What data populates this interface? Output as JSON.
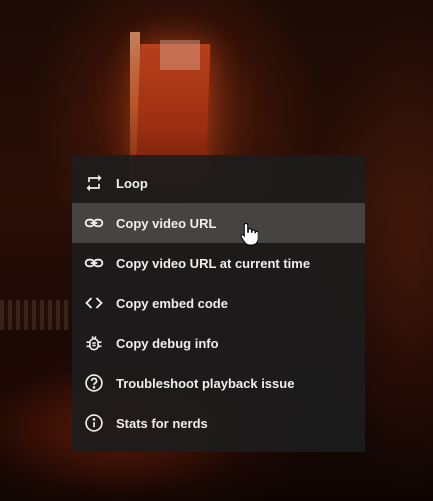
{
  "menu": {
    "items": [
      {
        "label": "Loop",
        "icon": "loop-icon"
      },
      {
        "label": "Copy video URL",
        "icon": "link-icon",
        "hovered": true
      },
      {
        "label": "Copy video URL at current time",
        "icon": "link-icon"
      },
      {
        "label": "Copy embed code",
        "icon": "code-icon"
      },
      {
        "label": "Copy debug info",
        "icon": "bug-icon"
      },
      {
        "label": "Troubleshoot playback issue",
        "icon": "question-icon"
      },
      {
        "label": "Stats for nerds",
        "icon": "info-icon"
      }
    ]
  },
  "colors": {
    "menu_background": "#1c1c1c",
    "menu_text": "#eeeeee",
    "hover_background": "#4a4a4a"
  }
}
